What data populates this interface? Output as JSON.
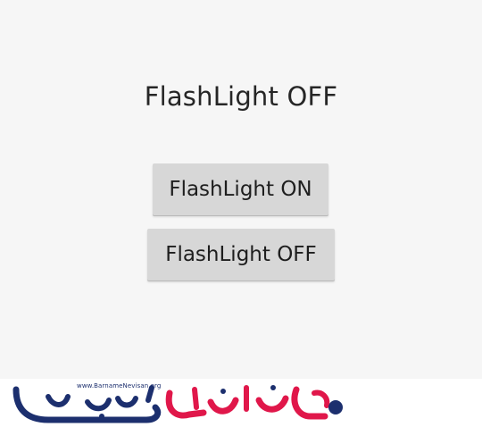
{
  "app": {
    "status_text": "FlashLight OFF"
  },
  "buttons": {
    "on_label": "FlashLight ON",
    "off_label": "FlashLight OFF"
  },
  "footer": {
    "logo_url": "www.BarnameNevisan.org"
  },
  "colors": {
    "screen_background": "#f6f6f6",
    "button_background": "#d7d7d7",
    "text": "#262626",
    "logo_navy": "#1c2f6e",
    "logo_red": "#e0174a"
  }
}
